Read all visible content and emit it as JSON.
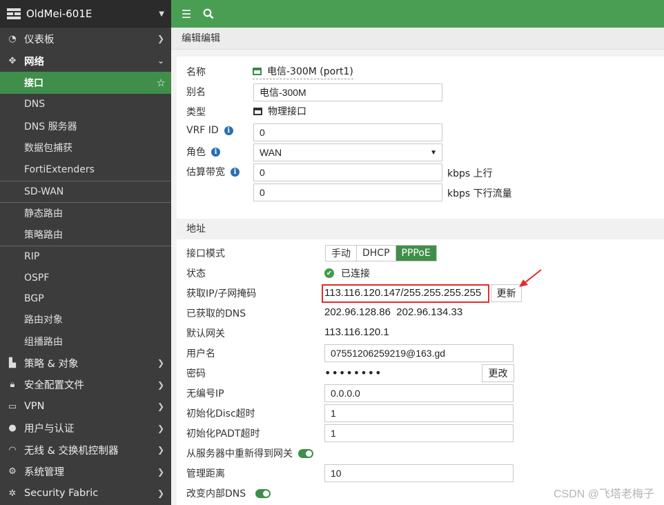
{
  "brand": {
    "title": "OldMei-601E"
  },
  "sidebar": {
    "items": [
      {
        "label": "仪表板",
        "icon": "dashboard-icon"
      },
      {
        "label": "网络",
        "icon": "network-icon"
      }
    ],
    "network_sub": [
      {
        "label": "接口",
        "active": true
      },
      {
        "label": "DNS"
      },
      {
        "label": "DNS 服务器"
      },
      {
        "label": "数据包捕获"
      },
      {
        "label": "FortiExtenders"
      },
      {
        "label": "SD-WAN"
      },
      {
        "label": "静态路由"
      },
      {
        "label": "策略路由"
      },
      {
        "label": "RIP"
      },
      {
        "label": "OSPF"
      },
      {
        "label": "BGP"
      },
      {
        "label": "路由对象"
      },
      {
        "label": "组播路由"
      }
    ],
    "bottom": [
      {
        "label": "策略 & 对象",
        "icon": "policy-icon"
      },
      {
        "label": "安全配置文件",
        "icon": "lock-icon"
      },
      {
        "label": "VPN",
        "icon": "laptop-icon"
      },
      {
        "label": "用户与认证",
        "icon": "user-icon"
      },
      {
        "label": "无线 & 交换机控制器",
        "icon": "wifi-icon"
      },
      {
        "label": "系统管理",
        "icon": "gear-icon"
      },
      {
        "label": "Security Fabric",
        "icon": "fabric-icon"
      }
    ]
  },
  "page": {
    "title": "编辑编辑"
  },
  "form": {
    "name_label": "名称",
    "name_value": "电信-300M (port1)",
    "alias_label": "别名",
    "alias_value": "电信-300M",
    "type_label": "类型",
    "type_value": "物理接口",
    "vrf_label": "VRF ID",
    "vrf_value": "0",
    "role_label": "角色",
    "role_value": "WAN",
    "bandwidth_label": "估算带宽",
    "bw_up_value": "0",
    "bw_up_unit": "kbps 上行",
    "bw_down_value": "0",
    "bw_down_unit": "kbps 下行流量"
  },
  "address": {
    "section_title": "地址",
    "mode_label": "接口模式",
    "modes": [
      "手动",
      "DHCP",
      "PPPoE"
    ],
    "active_mode": "PPPoE",
    "status_label": "状态",
    "status_value": "已连接",
    "ip_label": "获取IP/子网掩码",
    "ip_value": "113.116.120.147/255.255.255.255",
    "refresh_button": "更新",
    "dns_label": "已获取的DNS",
    "dns_value": "202.96.128.86  202.96.134.33",
    "gateway_label": "默认网关",
    "gateway_value": "113.116.120.1",
    "username_label": "用户名",
    "username_value": "07551206259219@163.gd",
    "password_label": "密码",
    "password_value": "••••••••",
    "change_button": "更改",
    "unnumbered_label": "无编号IP",
    "unnumbered_value": "0.0.0.0",
    "disc_label": "初始化Disc超时",
    "disc_value": "1",
    "padt_label": "初始化PADT超时",
    "padt_value": "1",
    "gw_from_server_label": "从服务器中重新得到网关",
    "distance_label": "管理距离",
    "distance_value": "10",
    "dns_change_label": "改变内部DNS"
  },
  "watermark": "CSDN @飞塔老梅子",
  "colors": {
    "accent": "#4a9e54",
    "sidebar": "#3c3c3c",
    "highlight": "#e32b2b"
  }
}
